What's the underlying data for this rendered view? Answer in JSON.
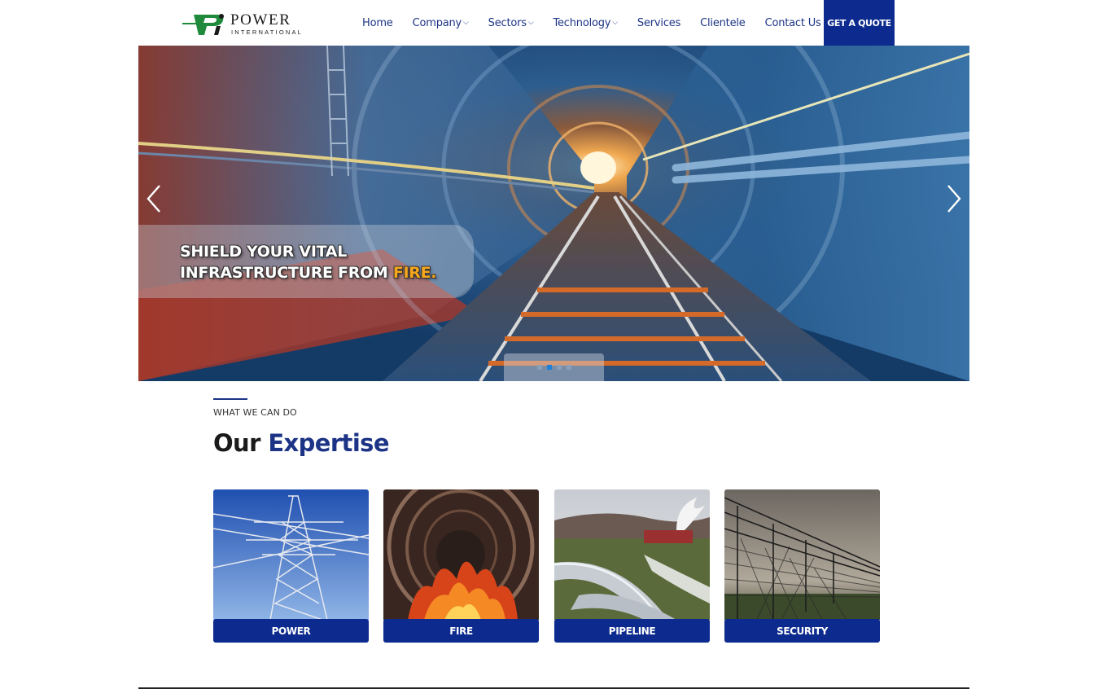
{
  "brand": {
    "logo_mark": "PI",
    "name": "POWER",
    "tagline": "INTERNATIONAL",
    "colors": {
      "mark_green": "#1f8a3b",
      "mark_dark": "#1b1b1b"
    }
  },
  "nav": {
    "items": [
      {
        "label": "Home",
        "has_dropdown": false
      },
      {
        "label": "Company",
        "has_dropdown": true
      },
      {
        "label": "Sectors",
        "has_dropdown": true
      },
      {
        "label": "Technology",
        "has_dropdown": true
      },
      {
        "label": "Services",
        "has_dropdown": false
      },
      {
        "label": "Clientele",
        "has_dropdown": false
      },
      {
        "label": "Contact Us",
        "has_dropdown": false
      }
    ],
    "dropdown_glyph": "⌵",
    "cta_label": "GET A QUOTE",
    "colors": {
      "link": "#1d3486",
      "cta_bg": "#0d2b8e"
    }
  },
  "hero": {
    "caption_line1": "SHIELD YOUR VITAL",
    "caption_line2_prefix": "INFRASTRUCTURE FROM ",
    "caption_line2_highlight": "FIRE.",
    "slide_count": 4,
    "active_slide": 2,
    "prev_icon": "chevron-left-icon",
    "next_icon": "chevron-right-icon",
    "colors": {
      "highlight": "#f5a61c",
      "active_dot": "#1e7fd8",
      "inactive_dot": "#8aa0b8"
    }
  },
  "expertise": {
    "kicker": "WHAT WE CAN DO",
    "title_plain": "Our",
    "title_accent": "Expertise",
    "cards": [
      {
        "label": "POWER"
      },
      {
        "label": "FIRE"
      },
      {
        "label": "PIPELINE"
      },
      {
        "label": "SECURITY"
      }
    ],
    "colors": {
      "accent": "#1d3486",
      "card_bar": "#0d2b8e"
    }
  }
}
